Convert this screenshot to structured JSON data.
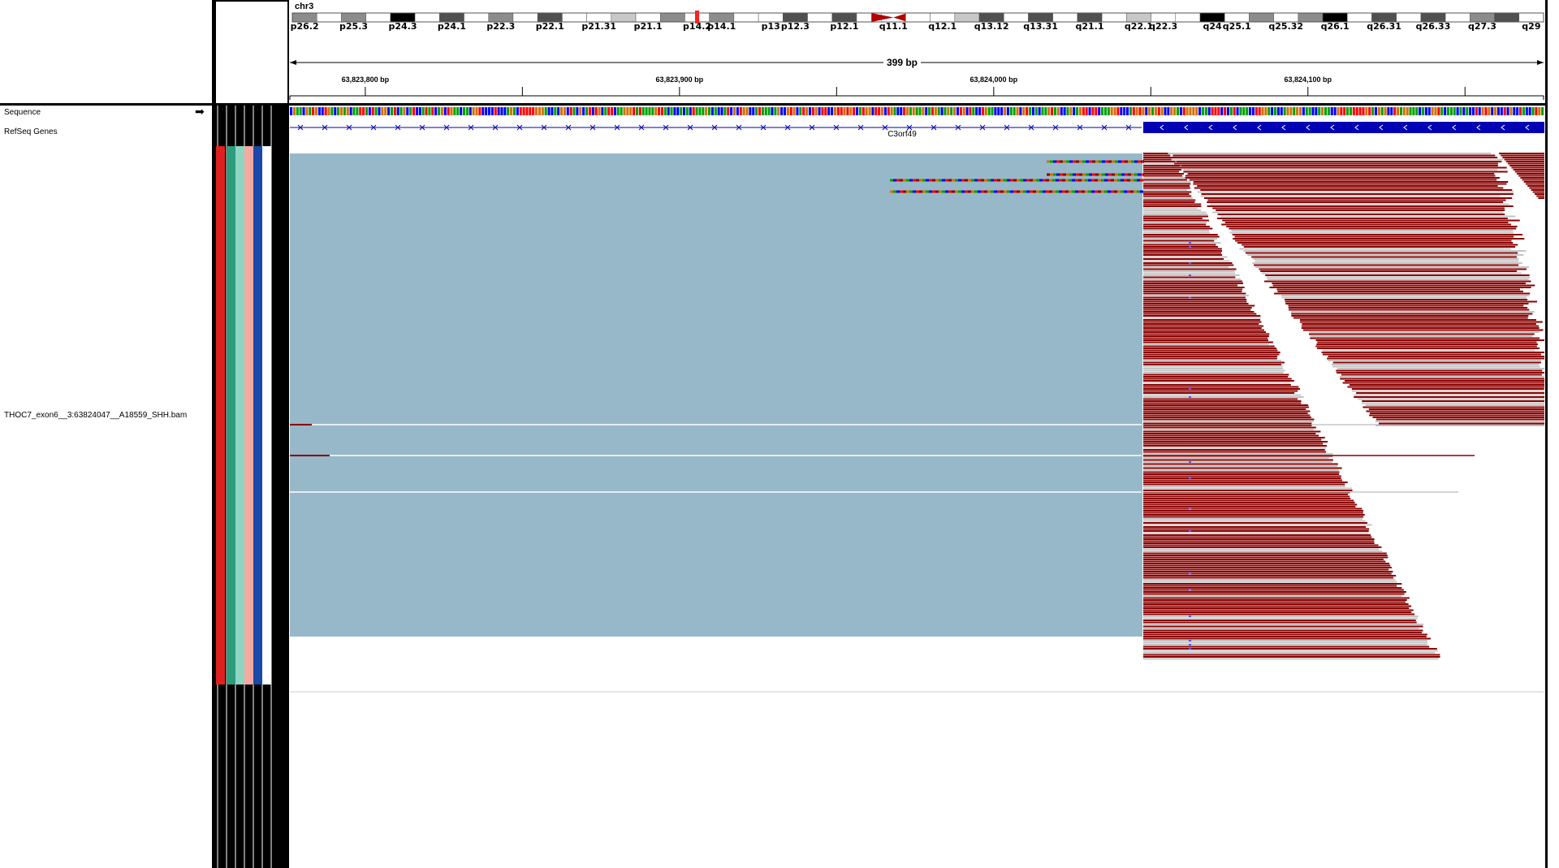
{
  "locus": {
    "chromosome": "chr3",
    "span_label": "399 bp",
    "cytobands": [
      {
        "name": "p26.2",
        "stain": "gpos50"
      },
      {
        "name": "",
        "stain": "gneg"
      },
      {
        "name": "p25.3",
        "stain": "gpos50"
      },
      {
        "name": "",
        "stain": "gneg"
      },
      {
        "name": "p24.3",
        "stain": "gpos100"
      },
      {
        "name": "",
        "stain": "gneg"
      },
      {
        "name": "p24.1",
        "stain": "gpos75"
      },
      {
        "name": "",
        "stain": "gneg"
      },
      {
        "name": "p22.3",
        "stain": "gpos50"
      },
      {
        "name": "",
        "stain": "gneg"
      },
      {
        "name": "p22.1",
        "stain": "gpos75"
      },
      {
        "name": "",
        "stain": "gneg"
      },
      {
        "name": "p21.31",
        "stain": "gneg"
      },
      {
        "name": "",
        "stain": "gpos25"
      },
      {
        "name": "p21.1",
        "stain": "gneg"
      },
      {
        "name": "",
        "stain": "gpos50"
      },
      {
        "name": "p14.2",
        "stain": "gneg"
      },
      {
        "name": "p14.1",
        "stain": "gpos50"
      },
      {
        "name": "",
        "stain": "gneg"
      },
      {
        "name": "p13",
        "stain": "gneg"
      },
      {
        "name": "p12.3",
        "stain": "gpos75"
      },
      {
        "name": "",
        "stain": "gneg"
      },
      {
        "name": "p12.1",
        "stain": "gpos75"
      },
      {
        "name": "",
        "stain": "gneg"
      },
      {
        "name": "q11.1",
        "stain": "acen"
      },
      {
        "name": "",
        "stain": "gneg"
      },
      {
        "name": "q12.1",
        "stain": "gneg"
      },
      {
        "name": "",
        "stain": "gpos25"
      },
      {
        "name": "q13.12",
        "stain": "gpos75"
      },
      {
        "name": "",
        "stain": "gneg"
      },
      {
        "name": "q13.31",
        "stain": "gpos75"
      },
      {
        "name": "",
        "stain": "gneg"
      },
      {
        "name": "q21.1",
        "stain": "gpos75"
      },
      {
        "name": "",
        "stain": "gneg"
      },
      {
        "name": "q22.1",
        "stain": "gpos25"
      },
      {
        "name": "q22.3",
        "stain": "gneg"
      },
      {
        "name": "",
        "stain": "gneg"
      },
      {
        "name": "q24",
        "stain": "gpos100"
      },
      {
        "name": "q25.1",
        "stain": "gneg"
      },
      {
        "name": "",
        "stain": "gpos50"
      },
      {
        "name": "q25.32",
        "stain": "gneg"
      },
      {
        "name": "",
        "stain": "gpos50"
      },
      {
        "name": "q26.1",
        "stain": "gpos100"
      },
      {
        "name": "",
        "stain": "gneg"
      },
      {
        "name": "q26.31",
        "stain": "gpos75"
      },
      {
        "name": "",
        "stain": "gneg"
      },
      {
        "name": "q26.33",
        "stain": "gpos75"
      },
      {
        "name": "",
        "stain": "gneg"
      },
      {
        "name": "q27.3",
        "stain": "gpos50"
      },
      {
        "name": "",
        "stain": "gpos75"
      },
      {
        "name": "q29",
        "stain": "gneg"
      }
    ],
    "ruler_ticks": [
      {
        "label": "63,823,800 bp",
        "pos": 63823800
      },
      {
        "label": "63,823,900 bp",
        "pos": 63823900
      },
      {
        "label": "63,824,000 bp",
        "pos": 63824000
      },
      {
        "label": "63,824,100 bp",
        "pos": 63824100
      }
    ],
    "view_start": 63823776,
    "view_end": 63824175
  },
  "tracks": {
    "sequence_label": "Sequence",
    "refseq_label": "RefSeq Genes",
    "bam_label": "THOC7_exon6__3:63824047__A18559_SHH.bam",
    "gene_name": "C3orf49"
  },
  "colors": {
    "coverage_blue": "#97b8c9",
    "read_red": "#8b0000",
    "read_gray": "#c4c4c4",
    "gene_blue": "#0000b4",
    "attr_cols": [
      "#e02020",
      "#2e9c7c",
      "#8ed6c2",
      "#f5a9a0",
      "#1a48a8",
      "#ffffff"
    ]
  }
}
